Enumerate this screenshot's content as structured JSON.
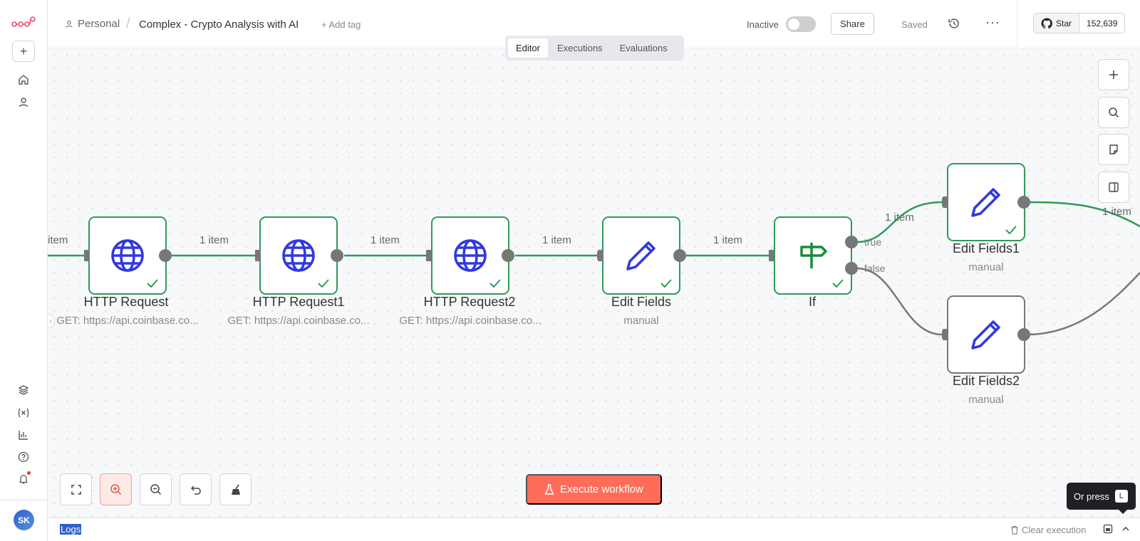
{
  "header": {
    "project": "Personal",
    "workflow_title": "Complex - Crypto Analysis with AI",
    "add_tag": "+ Add tag",
    "status_label": "Inactive",
    "share_label": "Share",
    "saved_label": "Saved",
    "more_label": "···",
    "github": {
      "star_label": "Star",
      "star_count": "152,639"
    }
  },
  "tabs": [
    {
      "label": "Editor",
      "active": true
    },
    {
      "label": "Executions",
      "active": false
    },
    {
      "label": "Evaluations",
      "active": false
    }
  ],
  "sidebar": {
    "avatar_initials": "SK",
    "icons": [
      "home-icon",
      "user-icon",
      "templates-icon",
      "variables-icon",
      "insights-icon",
      "help-icon",
      "notifications-icon"
    ]
  },
  "canvas": {
    "edge_labels": {
      "e0": "item",
      "e1": "1 item",
      "e2": "1 item",
      "e3": "1 item",
      "e4": "1 item",
      "e_true": "1 item",
      "e_out": "1 item"
    },
    "port_labels": {
      "true": "true",
      "false": "false"
    },
    "nodes": [
      {
        "title": "HTTP Request",
        "subtitle": "GET: https://api.coinbase.co...",
        "icon": "globe-icon",
        "status": "success"
      },
      {
        "title": "HTTP Request1",
        "subtitle": "GET: https://api.coinbase.co...",
        "icon": "globe-icon",
        "status": "success"
      },
      {
        "title": "HTTP Request2",
        "subtitle": "GET: https://api.coinbase.co...",
        "icon": "globe-icon",
        "status": "success"
      },
      {
        "title": "Edit Fields",
        "subtitle": "manual",
        "icon": "pencil-icon",
        "status": "success"
      },
      {
        "title": "If",
        "subtitle": "",
        "icon": "signpost-icon",
        "status": "success"
      },
      {
        "title": "Edit Fields1",
        "subtitle": "manual",
        "icon": "pencil-icon",
        "status": "success"
      },
      {
        "title": "Edit Fields2",
        "subtitle": "manual",
        "icon": "pencil-icon",
        "status": "not-executed"
      }
    ]
  },
  "controls": {
    "execute_label": "Execute workflow",
    "tooltip_text": "Or press",
    "tooltip_key": "L"
  },
  "logs": {
    "label": "Logs",
    "clear_label": "Clear execution"
  },
  "colors": {
    "success": "#2e9b55",
    "accent": "#ff6d5a",
    "node_icon": "#3038e0",
    "if_icon": "#1a8a3a"
  }
}
